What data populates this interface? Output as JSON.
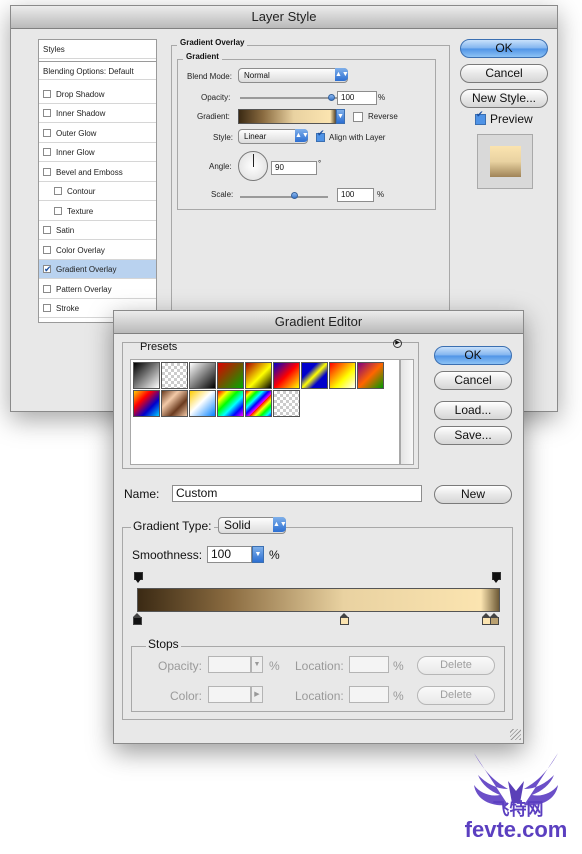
{
  "layer_style": {
    "title": "Layer Style",
    "styles_list": [
      {
        "label": "Styles",
        "kind": "header"
      },
      {
        "label": "Blending Options: Default",
        "kind": "header"
      },
      {
        "label": "Drop Shadow",
        "checked": false
      },
      {
        "label": "Inner Shadow",
        "checked": false
      },
      {
        "label": "Outer Glow",
        "checked": false
      },
      {
        "label": "Inner Glow",
        "checked": false
      },
      {
        "label": "Bevel and Emboss",
        "checked": false
      },
      {
        "label": "Contour",
        "checked": false,
        "sub": true
      },
      {
        "label": "Texture",
        "checked": false,
        "sub": true
      },
      {
        "label": "Satin",
        "checked": false
      },
      {
        "label": "Color Overlay",
        "checked": false
      },
      {
        "label": "Gradient Overlay",
        "checked": true,
        "selected": true
      },
      {
        "label": "Pattern Overlay",
        "checked": false
      },
      {
        "label": "Stroke",
        "checked": false
      }
    ],
    "section_title": "Gradient Overlay",
    "subsection_title": "Gradient",
    "blend_mode_label": "Blend Mode:",
    "blend_mode_value": "Normal",
    "opacity_label": "Opacity:",
    "opacity_value": "100",
    "percent": "%",
    "gradient_label": "Gradient:",
    "reverse_label": "Reverse",
    "style_label": "Style:",
    "style_value": "Linear",
    "align_label": "Align with Layer",
    "angle_label": "Angle:",
    "angle_value": "90",
    "degree": "°",
    "scale_label": "Scale:",
    "scale_value": "100",
    "ok": "OK",
    "cancel": "Cancel",
    "new_style": "New Style...",
    "preview_label": "Preview"
  },
  "gradient_editor": {
    "title": "Gradient Editor",
    "presets_label": "Presets",
    "ok": "OK",
    "cancel": "Cancel",
    "load": "Load...",
    "save": "Save...",
    "name_label": "Name:",
    "name_value": "Custom",
    "new_button": "New",
    "gradient_type_label": "Gradient Type:",
    "gradient_type_value": "Solid",
    "smoothness_label": "Smoothness:",
    "smoothness_value": "100",
    "percent": "%",
    "stops_label": "Stops",
    "opacity_label": "Opacity:",
    "location_label": "Location:",
    "delete_label": "Delete",
    "color_label": "Color:"
  },
  "gradient_colors": {
    "dark": "#3b2a14",
    "mid": "#e9d2a1",
    "light": "#fbe4b0"
  },
  "accent_blue": "#4f93e6",
  "watermark": {
    "line1": "飞特网",
    "line2": "fevte.com"
  }
}
